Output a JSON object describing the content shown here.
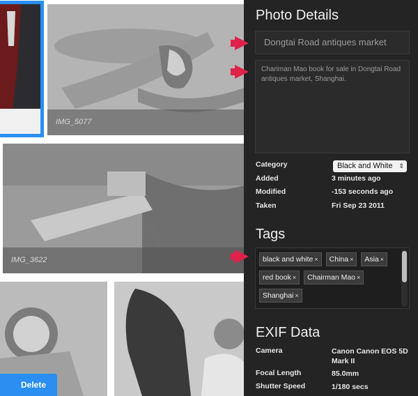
{
  "gallery": {
    "photos": [
      {
        "caption": ""
      },
      {
        "caption": "IMG_5077"
      },
      {
        "caption": "IMG_3622"
      },
      {
        "caption": ""
      },
      {
        "caption": ""
      }
    ],
    "delete_label": "Delete"
  },
  "details": {
    "heading": "Photo Details",
    "title_value": "Dongtai Road antiques market",
    "description_value": "Chariman Mao book for sale in Dongtai Road antiques market, Shanghai.",
    "category_label": "Category",
    "category_value": "Black and White",
    "added_label": "Added",
    "added_value": "3 minutes ago",
    "modified_label": "Modified",
    "modified_value": "-153 seconds ago",
    "taken_label": "Taken",
    "taken_value": "Fri Sep 23 2011"
  },
  "tags": {
    "heading": "Tags",
    "items": [
      "black and white",
      "China",
      "Asia",
      "red book",
      "Chairman Mao",
      "Shanghai"
    ],
    "remove_glyph": "×"
  },
  "exif": {
    "heading": "EXIF Data",
    "camera_label": "Camera",
    "camera_value": "Canon Canon EOS 5D Mark II",
    "focal_label": "Focal Length",
    "focal_value": "85.0mm",
    "shutter_label": "Shutter Speed",
    "shutter_value": "1/180 secs"
  },
  "colors": {
    "accent": "#2a8ff0",
    "arrow": "#e0224a",
    "panel_bg": "#242424"
  }
}
